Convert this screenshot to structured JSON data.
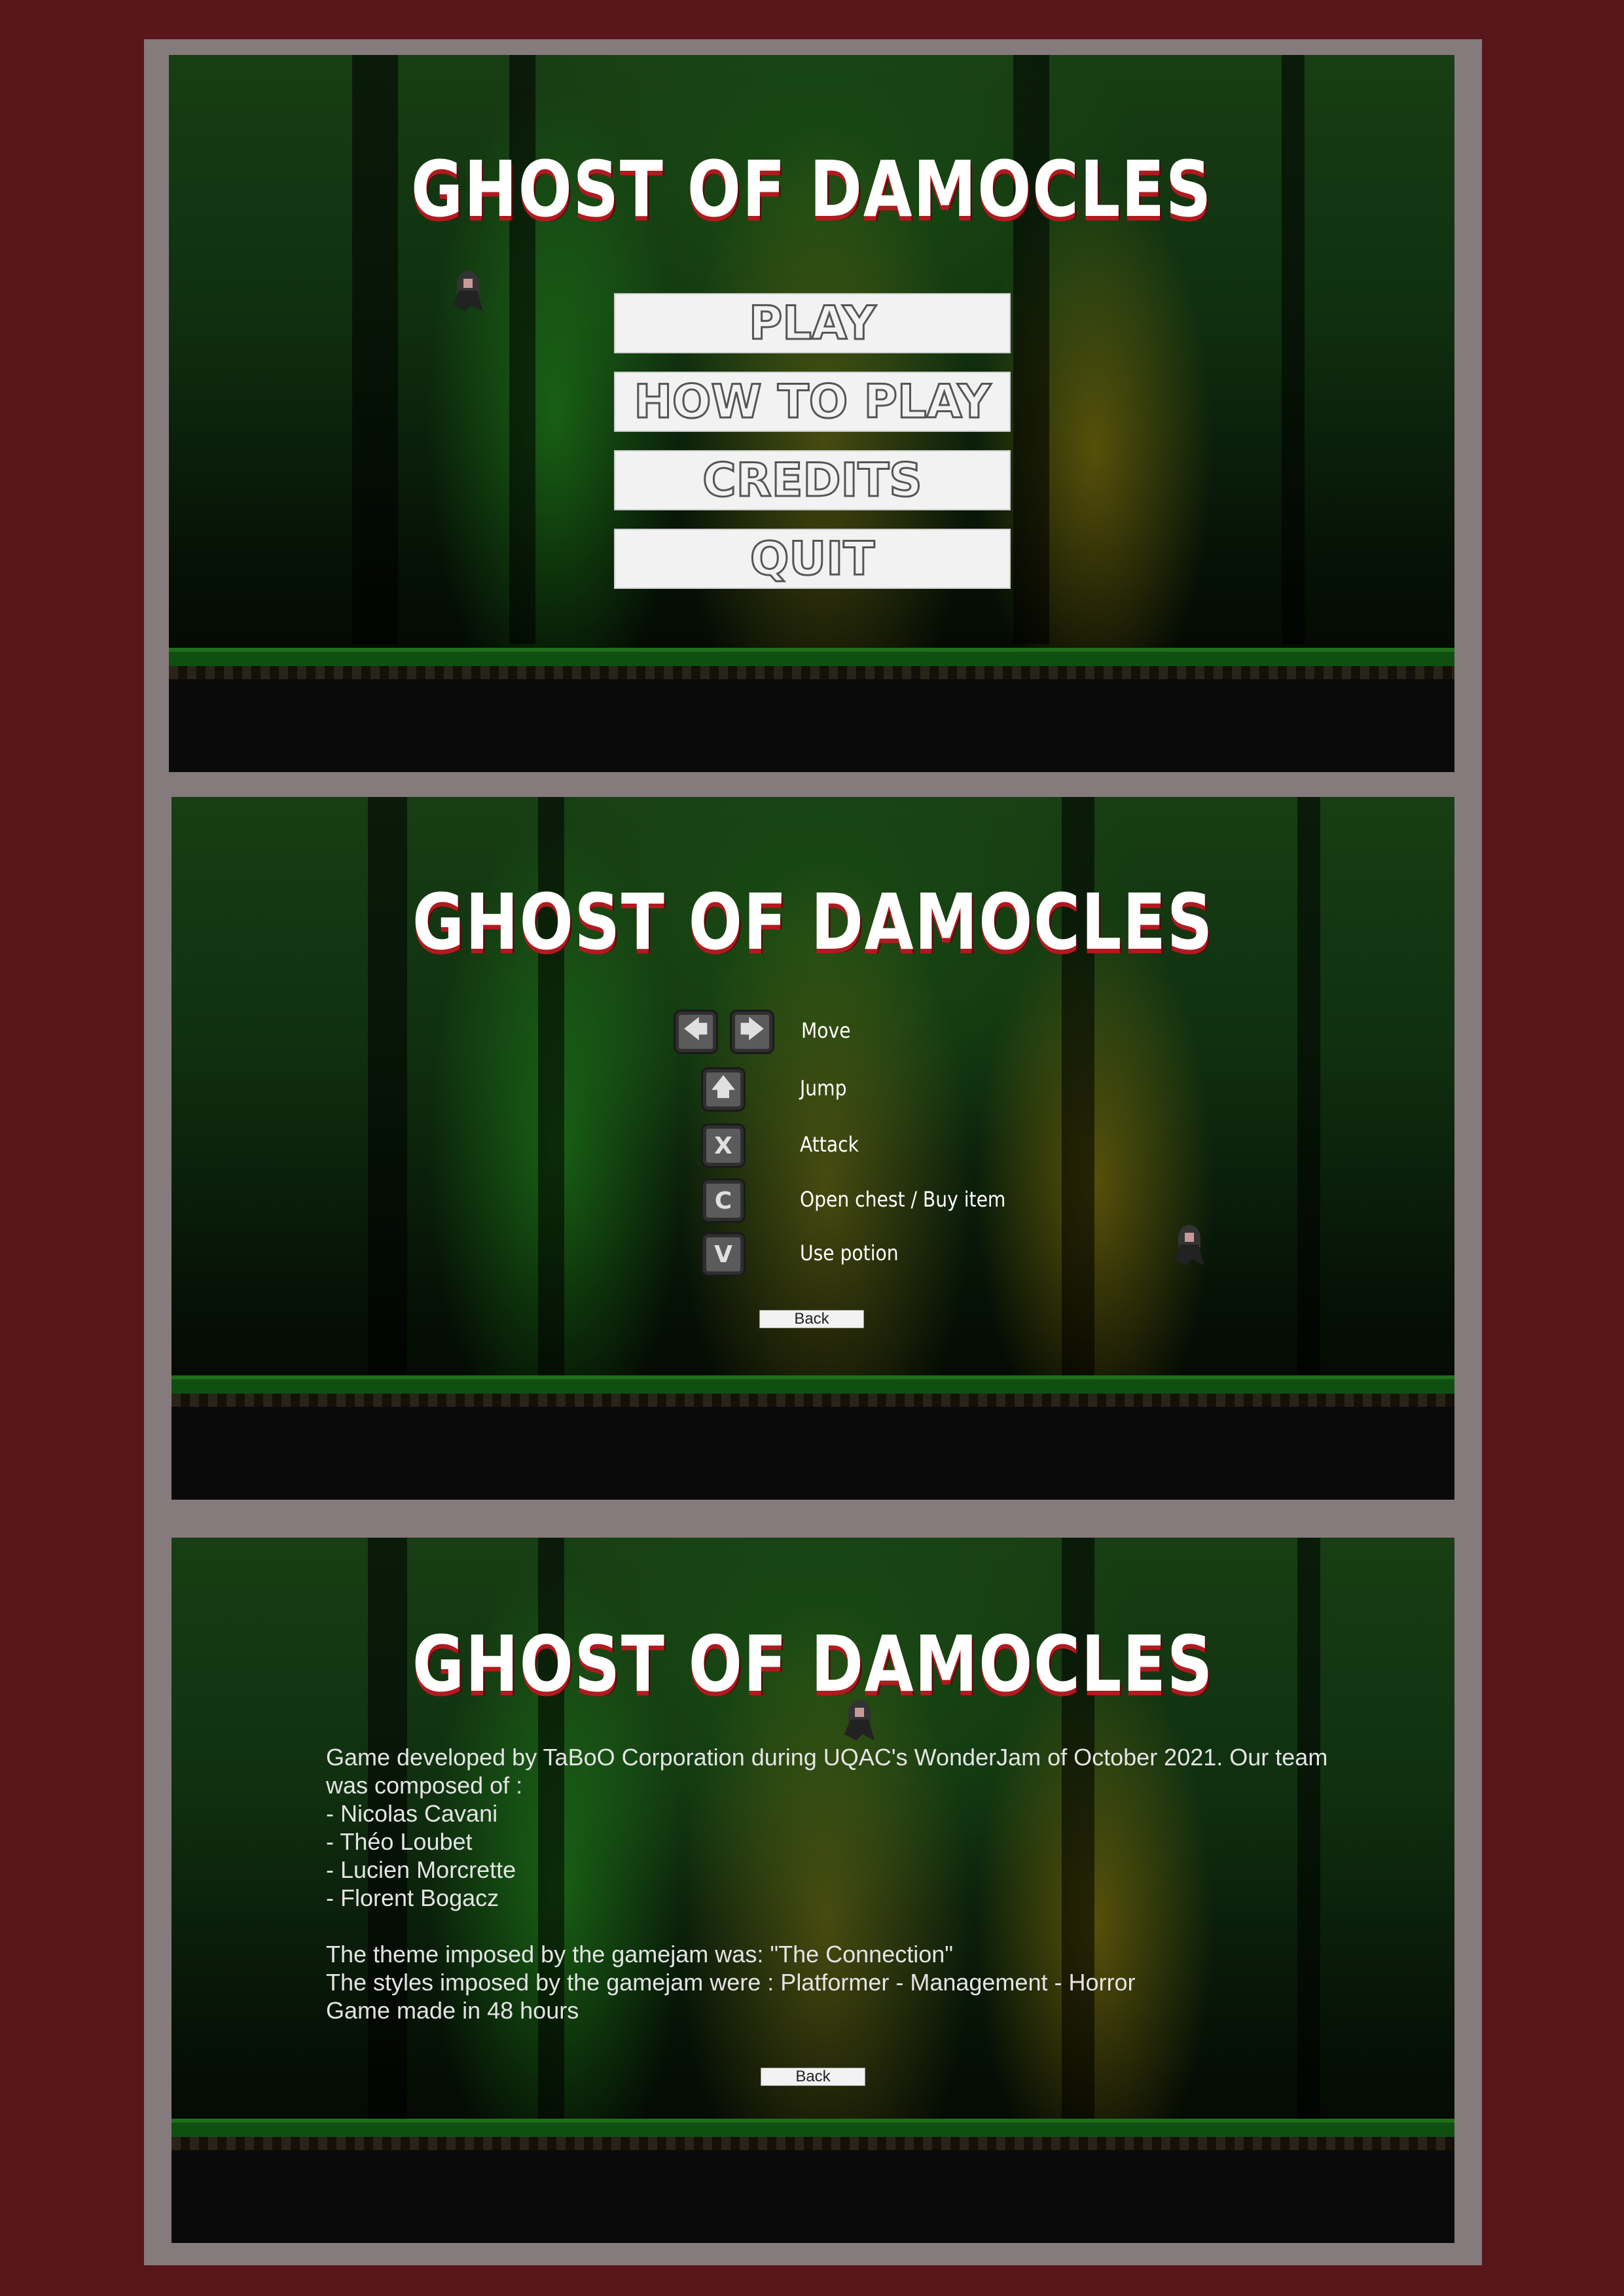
{
  "game_title": "GHOST OF DAMOCLES",
  "main_menu": {
    "buttons": [
      "PLAY",
      "HOW TO PLAY",
      "CREDITS",
      "QUIT"
    ]
  },
  "how_to_play": {
    "controls": [
      {
        "keys": [
          "left-arrow",
          "right-arrow"
        ],
        "label": "Move"
      },
      {
        "keys": [
          "up-arrow"
        ],
        "label": "Jump"
      },
      {
        "keys": [
          "X"
        ],
        "label": "Attack"
      },
      {
        "keys": [
          "C"
        ],
        "label": "Open chest / Buy item"
      },
      {
        "keys": [
          "V"
        ],
        "label": "Use potion"
      }
    ],
    "key_glyphs": {
      "left": "🡄",
      "right": "🡆",
      "up": "🡅",
      "x": "X",
      "c": "C",
      "v": "V"
    },
    "back_label": "Back"
  },
  "credits": {
    "text": "Game developed by TaBoO Corporation during UQAC's WonderJam of October 2021. Our team was composed of :\n- Nicolas Cavani\n- Théo Loubet\n- Lucien Morcrette\n- Florent Bogacz\n\nThe theme imposed by the gamejam was:  \"The Connection\"\nThe styles imposed by the gamejam were : Platformer - Management - Horror\nGame made in 48 hours",
    "back_label": "Back"
  },
  "colors": {
    "outer_background": "#58161a",
    "frame": "#857b7c",
    "title_shadow": "#b11a1f",
    "button_fill": "#f2f2f2"
  }
}
